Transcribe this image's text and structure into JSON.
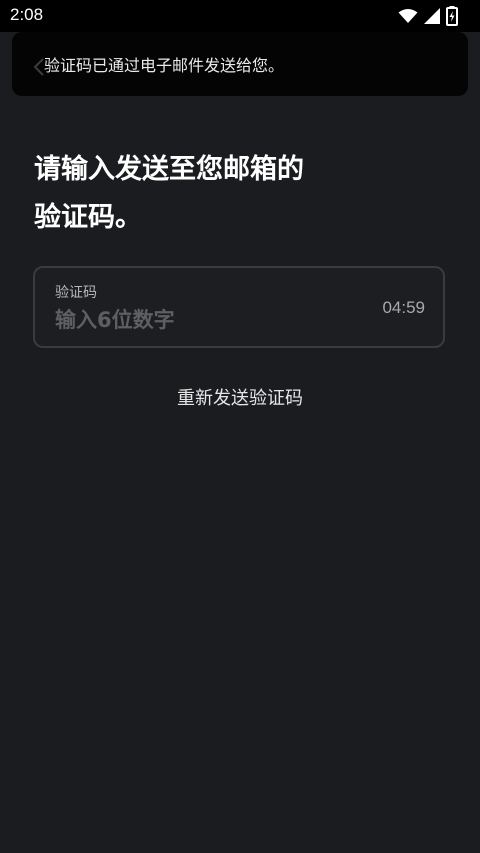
{
  "status_bar": {
    "time": "2:08",
    "icons": [
      "wifi-icon",
      "signal-icon",
      "battery-charging-icon"
    ]
  },
  "toast": {
    "message": "验证码已通过电子邮件发送给您。"
  },
  "heading": {
    "line1": "请输入发送至您邮箱的",
    "line2": "验证码。"
  },
  "code_field": {
    "label": "验证码",
    "placeholder": "输入6位数字",
    "value": "",
    "timer": "04:59"
  },
  "resend": {
    "label": "重新发送验证码"
  },
  "colors": {
    "background": "#1b1c1f",
    "toast_background": "#040404",
    "field_border": "#3a3b3f",
    "placeholder": "#5e5f63"
  }
}
